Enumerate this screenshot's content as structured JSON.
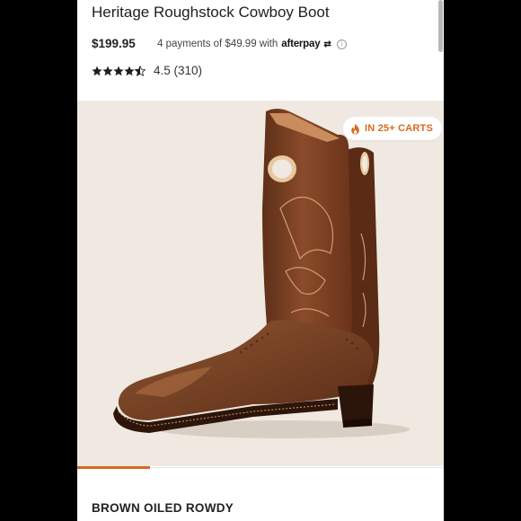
{
  "product": {
    "title": "Heritage Roughstock Cowboy Boot",
    "price": "$199.95",
    "installments_text": "4 payments of $49.99 with",
    "afterpay_label": "afterpay",
    "rating_value": 4.5,
    "rating_text": "4.5 (310)",
    "badge_text": "IN 25+ CARTS",
    "color_name": "BROWN OILED ROWDY"
  },
  "colors": {
    "accent": "#d9691e",
    "image_background": "#efe9e1",
    "boot_brown": "#7a3f22"
  },
  "icons": {
    "rating": "star-icon",
    "badge": "flame-icon",
    "info": "info-icon",
    "afterpay": "afterpay-arrows-icon"
  }
}
